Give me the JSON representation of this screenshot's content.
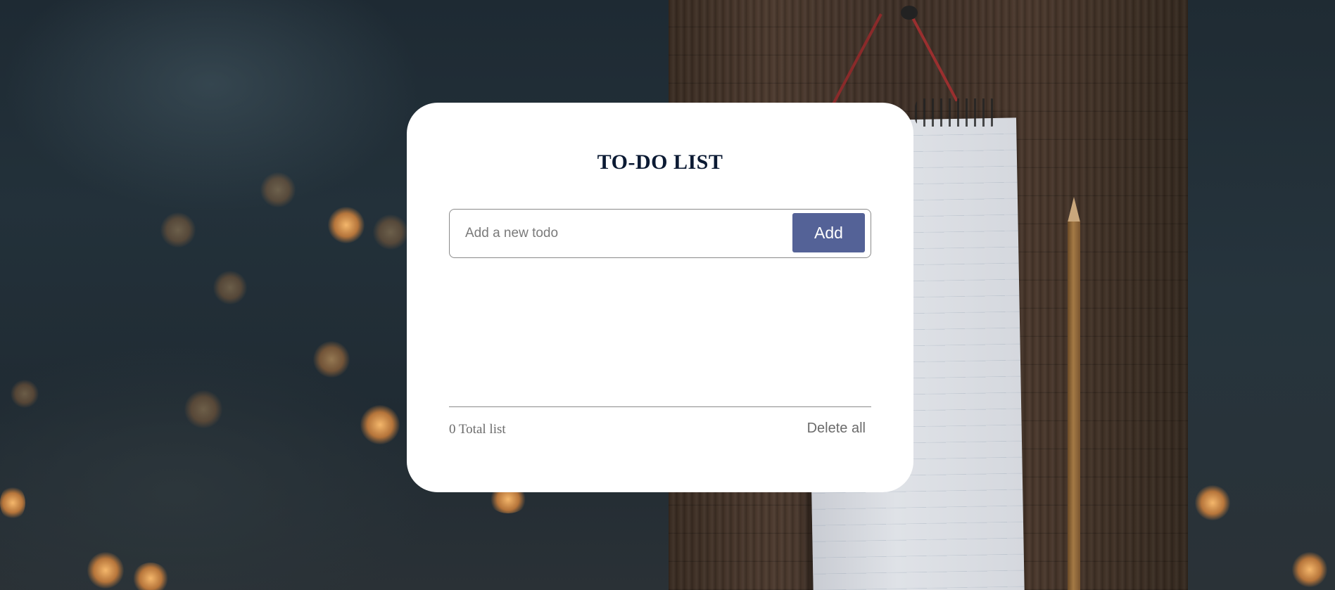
{
  "app": {
    "title": "TO-DO LIST"
  },
  "input": {
    "placeholder": "Add a new todo",
    "value": ""
  },
  "actions": {
    "add_label": "Add",
    "delete_all_label": "Delete all"
  },
  "todos": [],
  "footer": {
    "total_text": "0 Total list"
  },
  "colors": {
    "accent": "#546297",
    "title": "#0b1a33",
    "muted_text": "#6b6b6b",
    "card_background": "#ffffff"
  }
}
